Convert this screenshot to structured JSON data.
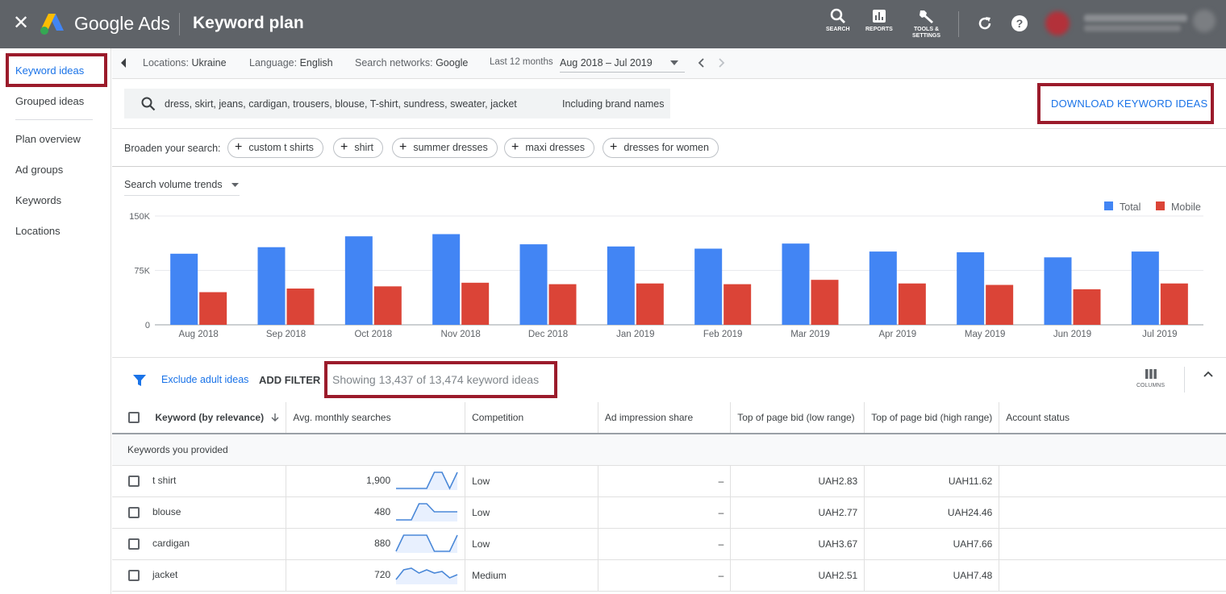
{
  "topbar": {
    "brand": "Google Ads",
    "title": "Keyword plan",
    "buttons": {
      "search": "SEARCH",
      "reports": "REPORTS",
      "tools_l1": "TOOLS &",
      "tools_l2": "SETTINGS"
    }
  },
  "sidenav": {
    "items": [
      "Keyword ideas",
      "Grouped ideas",
      "Plan overview",
      "Ad groups",
      "Keywords",
      "Locations"
    ]
  },
  "filters": {
    "locations_label": "Locations:",
    "locations_value": "Ukraine",
    "language_label": "Language:",
    "language_value": "English",
    "networks_label": "Search networks:",
    "networks_value": "Google",
    "period_label": "Last 12 months",
    "period_value": "Aug 2018 – Jul 2019"
  },
  "search": {
    "query": "dress, skirt, jeans, cardigan, trousers, blouse, T-shirt, sundress, sweater, jacket",
    "brand_names": "Including brand names",
    "download_label": "DOWNLOAD KEYWORD IDEAS"
  },
  "broaden": {
    "label": "Broaden your search:",
    "chips": [
      "custom t shirts",
      "shirt",
      "summer dresses",
      "maxi dresses",
      "dresses for women"
    ]
  },
  "chart_data": {
    "type": "bar",
    "title": "Search volume trends",
    "categories": [
      "Aug 2018",
      "Sep 2018",
      "Oct 2018",
      "Nov 2018",
      "Dec 2018",
      "Jan 2019",
      "Feb 2019",
      "Mar 2019",
      "Apr 2019",
      "May 2019",
      "Jun 2019",
      "Jul 2019"
    ],
    "series": [
      {
        "name": "Total",
        "color": "#4285f4",
        "values": [
          98000,
          107000,
          122000,
          125000,
          111000,
          108000,
          105000,
          112000,
          101000,
          100000,
          93000,
          101000
        ]
      },
      {
        "name": "Mobile",
        "color": "#db4437",
        "values": [
          45000,
          50000,
          53000,
          58000,
          56000,
          57000,
          56000,
          62000,
          57000,
          55000,
          49000,
          57000
        ]
      }
    ],
    "ylim": [
      0,
      150000
    ],
    "yticks": [
      0,
      75000,
      150000
    ],
    "ytick_labels": [
      "0",
      "75K",
      "150K"
    ],
    "grid": true,
    "legend": "top-right"
  },
  "toolbar": {
    "exclude": "Exclude adult ideas",
    "add_filter": "ADD FILTER",
    "showing": "Showing 13,437 of 13,474 keyword ideas",
    "columns": "COLUMNS"
  },
  "table": {
    "headers": [
      "Keyword (by relevance)",
      "Avg. monthly searches",
      "Competition",
      "Ad impression share",
      "Top of page bid (low range)",
      "Top of page bid (high range)",
      "Account status"
    ],
    "group_label": "Keywords you provided",
    "rows": [
      {
        "keyword": "t shirt",
        "searches": "1,900",
        "competition": "Low",
        "share": "–",
        "low": "UAH2.83",
        "high": "UAH11.62",
        "trend": [
          0,
          0,
          0,
          0,
          0,
          1,
          1,
          0,
          1
        ]
      },
      {
        "keyword": "blouse",
        "searches": "480",
        "competition": "Low",
        "share": "–",
        "low": "UAH2.77",
        "high": "UAH24.46",
        "trend": [
          0,
          0,
          0,
          1,
          1,
          0.5,
          0.5,
          0.5,
          0.5
        ]
      },
      {
        "keyword": "cardigan",
        "searches": "880",
        "competition": "Low",
        "share": "–",
        "low": "UAH3.67",
        "high": "UAH7.66",
        "trend": [
          0,
          1,
          1,
          1,
          1,
          0,
          0,
          0,
          1
        ]
      },
      {
        "keyword": "jacket",
        "searches": "720",
        "competition": "Medium",
        "share": "–",
        "low": "UAH2.51",
        "high": "UAH7.48",
        "trend": [
          0.2,
          0.8,
          0.9,
          0.6,
          0.8,
          0.6,
          0.7,
          0.3,
          0.5
        ]
      }
    ]
  }
}
